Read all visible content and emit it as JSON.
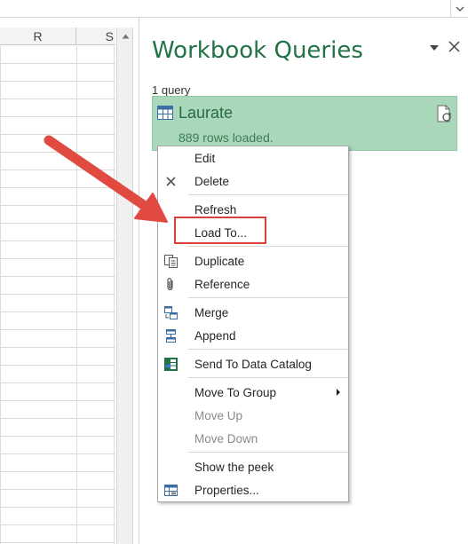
{
  "spreadsheet": {
    "columns": [
      "R",
      "S"
    ]
  },
  "pane": {
    "title": "Workbook Queries",
    "query_count": "1 query",
    "query": {
      "name": "Laurate",
      "rows_loaded": "889 rows loaded."
    }
  },
  "context_menu": {
    "items": [
      {
        "label": "Edit",
        "icon": "none",
        "enabled": true
      },
      {
        "label": "Delete",
        "icon": "delete-x-icon",
        "enabled": true
      },
      {
        "label": "Refresh",
        "icon": "none",
        "enabled": true
      },
      {
        "label": "Load To...",
        "icon": "none",
        "enabled": true
      },
      {
        "label": "Duplicate",
        "icon": "duplicate-icon",
        "enabled": true
      },
      {
        "label": "Reference",
        "icon": "paperclip-icon",
        "enabled": true
      },
      {
        "label": "Merge",
        "icon": "merge-icon",
        "enabled": true
      },
      {
        "label": "Append",
        "icon": "append-icon",
        "enabled": true
      },
      {
        "label": "Send To Data Catalog",
        "icon": "data-catalog-icon",
        "enabled": true
      },
      {
        "label": "Move To Group",
        "icon": "none",
        "enabled": true,
        "submenu": true
      },
      {
        "label": "Move Up",
        "icon": "none",
        "enabled": false
      },
      {
        "label": "Move Down",
        "icon": "none",
        "enabled": false
      },
      {
        "label": "Show the peek",
        "icon": "none",
        "enabled": true
      },
      {
        "label": "Properties...",
        "icon": "properties-icon",
        "enabled": true
      }
    ]
  },
  "colors": {
    "pane_title": "#217346",
    "query_card_bg": "#a8d8b9",
    "highlight_border": "#d6423a",
    "arrow": "#e04a40"
  }
}
